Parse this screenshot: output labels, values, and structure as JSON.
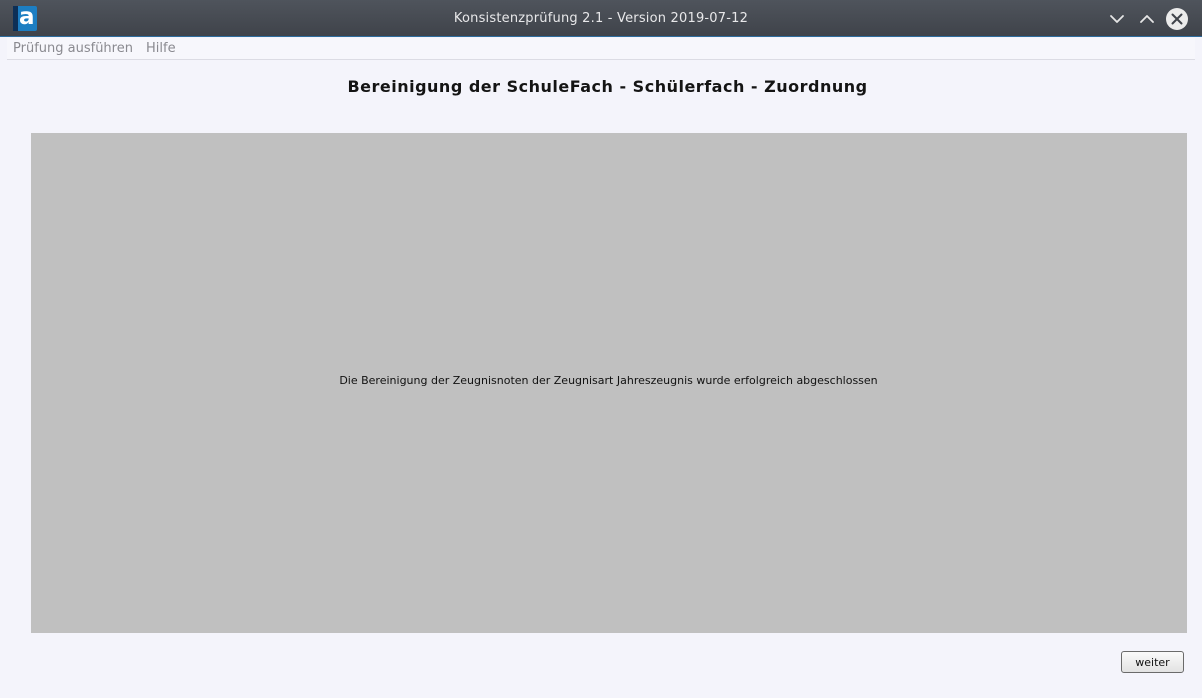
{
  "window": {
    "title": "Konsistenzprüfung 2.1 - Version 2019-07-12",
    "app_icon_letter": "a",
    "controls": {
      "minimize_icon": "chevron-down-icon",
      "maximize_icon": "chevron-up-icon",
      "close_icon": "close-icon"
    }
  },
  "menubar": {
    "items": [
      {
        "label": "Prüfung ausführen"
      },
      {
        "label": "Hilfe"
      }
    ]
  },
  "page": {
    "heading": "Bereinigung der SchuleFach - Schülerfach - Zuordnung",
    "message": "Die Bereinigung der Zeugnisnoten der Zeugnisart Jahreszeugnis wurde erfolgreich abgeschlossen"
  },
  "footer": {
    "next_label": "weiter"
  },
  "colors": {
    "titlebar": "#464a51",
    "panel": "#c0c0c0",
    "background": "#f4f4fb",
    "accent": "#1d7ec2"
  }
}
